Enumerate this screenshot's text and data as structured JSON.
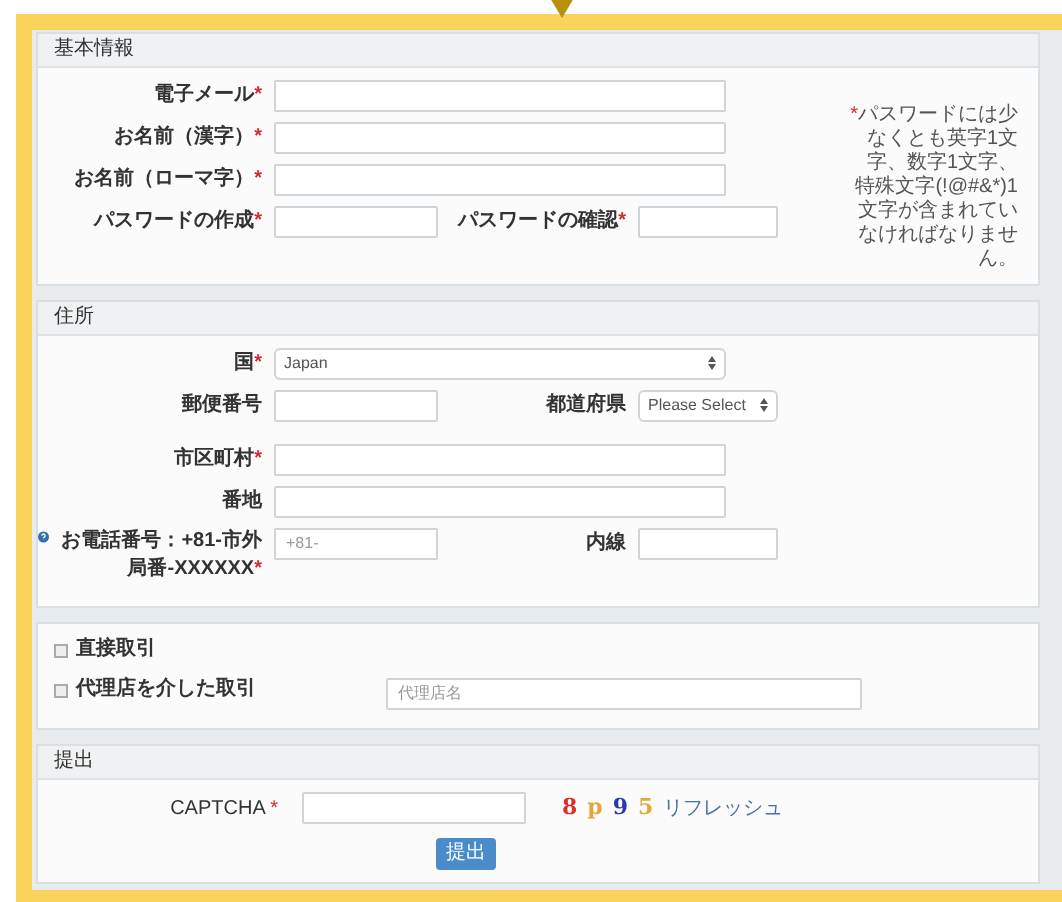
{
  "basic": {
    "title": "基本情報",
    "rows": [
      {
        "cells": [
          {
            "kind": "label",
            "text": "電子メール",
            "mark": "*"
          },
          {
            "kind": "input"
          }
        ]
      },
      {
        "cells": [
          {
            "kind": "label",
            "text": "お名前（漢字）",
            "mark": "*"
          },
          {
            "kind": "input"
          }
        ]
      },
      {
        "cells": [
          {
            "kind": "label",
            "text": "お名前（ローマ字）",
            "mark": "*"
          },
          {
            "kind": "input"
          }
        ]
      },
      {
        "cells": [
          {
            "kind": "label",
            "text": "パスワードの作成",
            "mark": "*"
          },
          {
            "kind": "input"
          },
          {
            "kind": "label",
            "text": "パスワードの確認",
            "mark": "*"
          },
          {
            "kind": "input"
          }
        ]
      }
    ],
    "note": {
      "mark": "*",
      "text": "パスワードには少なくとも英字1文字、数字1文字、特殊文字(!@#&*)1文字が含まれていなければなりません。"
    }
  },
  "address": {
    "title": "住所",
    "rows": [
      {
        "cells": [
          {
            "kind": "label",
            "text": "国",
            "mark": "*"
          },
          {
            "kind": "select",
            "value": "Japan"
          }
        ]
      },
      {
        "cells": [
          {
            "kind": "label",
            "text": "郵便番号"
          },
          {
            "kind": "input"
          },
          {
            "kind": "label",
            "text": "都道府県"
          },
          {
            "kind": "select",
            "value": "Please Select"
          }
        ]
      },
      {
        "cells": [
          {
            "kind": "label",
            "text": "市区町村",
            "mark": "*"
          },
          {
            "kind": "input"
          }
        ]
      },
      {
        "cells": [
          {
            "kind": "label",
            "text": "番地"
          },
          {
            "kind": "input"
          }
        ]
      },
      {
        "cells": [
          {
            "kind": "help-label",
            "text": "お電話番号：+81-市外局番-XXXXXX",
            "mark": "*"
          },
          {
            "kind": "input",
            "placeholder": "+81-"
          },
          {
            "kind": "label",
            "text": "内線"
          },
          {
            "kind": "input"
          }
        ]
      }
    ]
  },
  "trade": {
    "options": [
      {
        "label": "直接取引",
        "checked": false
      },
      {
        "label": "代理店を介した取引",
        "checked": false,
        "field": {
          "placeholder": "代理店名"
        }
      }
    ]
  },
  "submit": {
    "title": "提出",
    "captcha": {
      "label": "CAPTCHA",
      "mark": "*",
      "chars": [
        {
          "text": "8",
          "color": "#d8322b"
        },
        {
          "text": "p",
          "color": "#e0a93a"
        },
        {
          "text": "9",
          "color": "#2b3aa8"
        },
        {
          "text": "5",
          "color": "#e0a93a"
        }
      ],
      "refresh": "リフレッシュ"
    },
    "button": "提出"
  }
}
